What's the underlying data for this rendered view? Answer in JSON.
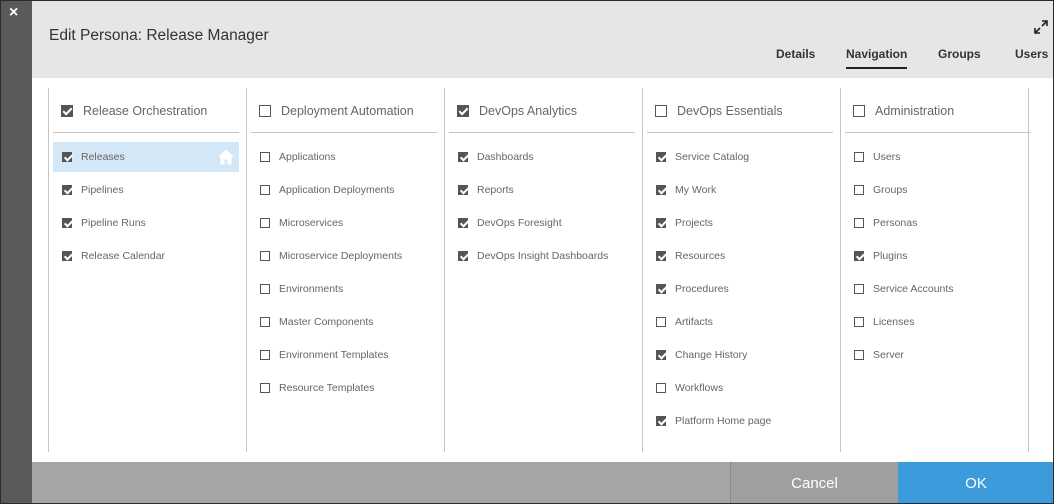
{
  "dialog": {
    "title": "Edit Persona: Release Manager",
    "close_glyph": "×"
  },
  "tabs": [
    {
      "label": "Details",
      "active": false
    },
    {
      "label": "Navigation",
      "active": true
    },
    {
      "label": "Groups",
      "active": false
    },
    {
      "label": "Users",
      "active": false
    }
  ],
  "columns": [
    {
      "header": {
        "label": "Release Orchestration",
        "checked": true
      },
      "items": [
        {
          "label": "Releases",
          "checked": true,
          "selected": true,
          "home": true
        },
        {
          "label": "Pipelines",
          "checked": true
        },
        {
          "label": "Pipeline Runs",
          "checked": true
        },
        {
          "label": "Release Calendar",
          "checked": true
        }
      ]
    },
    {
      "header": {
        "label": "Deployment Automation",
        "checked": false
      },
      "items": [
        {
          "label": "Applications",
          "checked": false
        },
        {
          "label": "Application Deployments",
          "checked": false
        },
        {
          "label": "Microservices",
          "checked": false
        },
        {
          "label": "Microservice Deployments",
          "checked": false
        },
        {
          "label": "Environments",
          "checked": false
        },
        {
          "label": "Master Components",
          "checked": false
        },
        {
          "label": "Environment Templates",
          "checked": false
        },
        {
          "label": "Resource Templates",
          "checked": false
        }
      ]
    },
    {
      "header": {
        "label": "DevOps Analytics",
        "checked": true
      },
      "items": [
        {
          "label": "Dashboards",
          "checked": true
        },
        {
          "label": "Reports",
          "checked": true
        },
        {
          "label": "DevOps Foresight",
          "checked": true
        },
        {
          "label": "DevOps Insight Dashboards",
          "checked": true
        }
      ]
    },
    {
      "header": {
        "label": "DevOps Essentials",
        "checked": false
      },
      "items": [
        {
          "label": "Service Catalog",
          "checked": true
        },
        {
          "label": "My Work",
          "checked": true
        },
        {
          "label": "Projects",
          "checked": true
        },
        {
          "label": "Resources",
          "checked": true
        },
        {
          "label": "Procedures",
          "checked": true
        },
        {
          "label": "Artifacts",
          "checked": false
        },
        {
          "label": "Change History",
          "checked": true
        },
        {
          "label": "Workflows",
          "checked": false
        },
        {
          "label": "Platform Home page",
          "checked": true
        }
      ]
    },
    {
      "header": {
        "label": "Administration",
        "checked": false
      },
      "items": [
        {
          "label": "Users",
          "checked": false
        },
        {
          "label": "Groups",
          "checked": false
        },
        {
          "label": "Personas",
          "checked": false
        },
        {
          "label": "Plugins",
          "checked": true
        },
        {
          "label": "Service Accounts",
          "checked": false
        },
        {
          "label": "Licenses",
          "checked": false
        },
        {
          "label": "Server",
          "checked": false
        }
      ]
    }
  ],
  "footer": {
    "cancel_label": "Cancel",
    "ok_label": "OK"
  },
  "colors": {
    "accent": "#3c9cdb",
    "selected_row": "#d4e7f6",
    "header_bg": "#e6e6e6",
    "footer_bg": "#a6a6a6"
  }
}
